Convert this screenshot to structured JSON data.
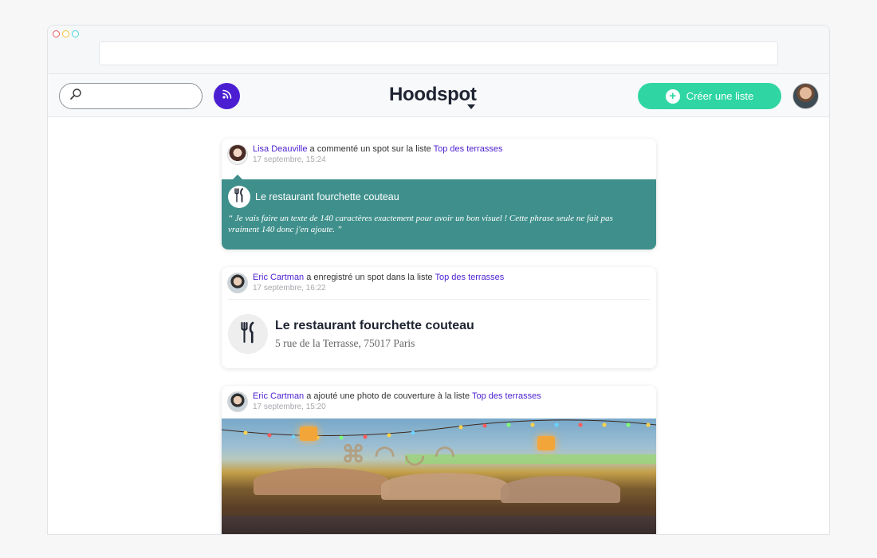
{
  "app": {
    "logo_text": "Hoodspot",
    "create_button_label": "Créer une liste",
    "colors": {
      "accent_purple": "#4b1fd1",
      "create_green": "#2fd6a3",
      "comment_teal": "#3f908c"
    },
    "icons": {
      "search": "search-icon",
      "feed": "rss-icon",
      "plus": "plus-icon",
      "spot": "cutlery-icon"
    }
  },
  "feed": [
    {
      "user": "Lisa Deauville",
      "action": " a commenté un spot sur la liste ",
      "list": "Top des terrasses",
      "time": "17 septembre, 15:24",
      "spot_name": "Le restaurant fourchette couteau",
      "comment": "“ Je vais faire un texte de 140 caractères exactement pour avoir un bon visuel ! Cette phrase seule ne fait pas vraiment 140 donc j'en ajoute. ”"
    },
    {
      "user": "Eric Cartman",
      "action": " a enregistré un spot dans la liste ",
      "list": "Top des terrasses",
      "time": "17 septembre, 16:22",
      "spot_name": "Le restaurant fourchette couteau",
      "address": "5 rue de la Terrasse, 75017 Paris"
    },
    {
      "user": "Eric Cartman",
      "action": " a ajouté une photo de couverture à la liste ",
      "list": "Top des terrasses",
      "time": "17 septembre, 15:20"
    }
  ]
}
